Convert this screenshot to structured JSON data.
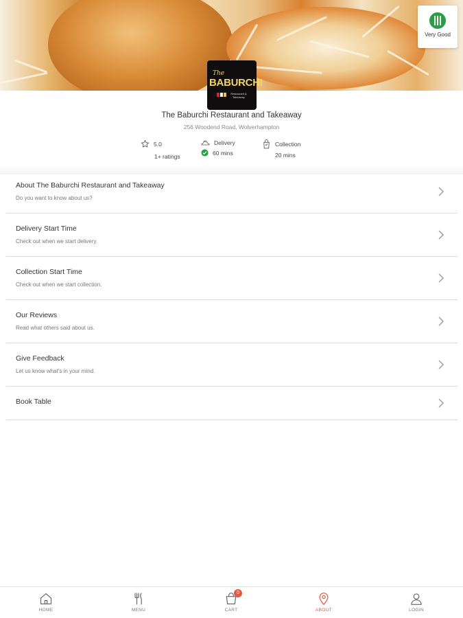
{
  "header": {
    "rating_badge_label": "Very Good",
    "logo_text": {
      "the": "The",
      "name": "BABURCHI",
      "sub": "Restaurant & Takeaway"
    }
  },
  "restaurant": {
    "name": "The Baburchi Restaurant and Takeaway",
    "address": "256 Woodend Road, Wolverhampton"
  },
  "stats": {
    "rating": {
      "value": "5.0",
      "count": "1+ ratings",
      "icon": "star-icon"
    },
    "delivery": {
      "label": "Delivery",
      "time": "60 mins",
      "icon": "delivery-icon",
      "status_icon": "check-circle-icon",
      "status_color": "#2e9b47"
    },
    "collection": {
      "label": "Collection",
      "time": "20 mins",
      "icon": "collection-bag-icon"
    }
  },
  "menu": [
    {
      "title": "About The Baburchi Restaurant and Takeaway",
      "desc": "Do you want to know about us?"
    },
    {
      "title": "Delivery Start Time",
      "desc": "Check out when we start delivery."
    },
    {
      "title": "Collection Start Time",
      "desc": "Check out when we start collection."
    },
    {
      "title": "Our Reviews",
      "desc": "Read what others said about us."
    },
    {
      "title": "Give Feedback",
      "desc": "Let us know what's in your mind."
    },
    {
      "title": "Book Table",
      "desc": ""
    }
  ],
  "nav": {
    "home": "HOME",
    "menu": "MENU",
    "cart": "CART",
    "cart_count": "0",
    "about": "ABOUT",
    "login": "LOGIN",
    "active": "about",
    "accent_color": "#e8573f"
  }
}
